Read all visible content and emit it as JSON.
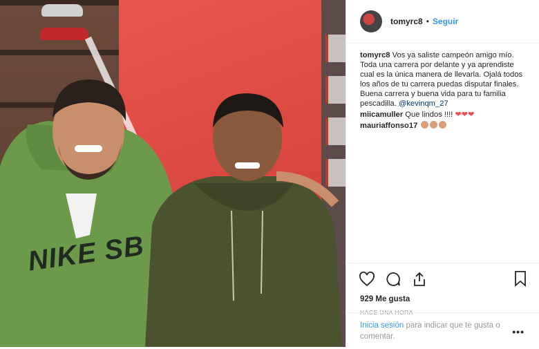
{
  "header": {
    "username": "tomyrc8",
    "separator": "•",
    "follow_label": "Seguir"
  },
  "caption": {
    "username": "tomyrc8",
    "text_before_mention": "Vos ya saliste campeón amigo mío. Toda una carrera por delante y ya aprendiste cual es la única manera de llevarla. Ojalá todos los años de tu carrera puedas disputar finales. Buena carrera y buena vida para tu familia pescadilla.",
    "mention": "@kevinqm_27"
  },
  "comments": [
    {
      "username": "miicamuller",
      "text": "Que lindos !!!!"
    },
    {
      "username": "mauriaffonso17",
      "text": ""
    }
  ],
  "likes": "929 Me gusta",
  "timestamp": "HACE UNA HORA",
  "login": {
    "link": "Inicia sesión",
    "rest": " para indicar que te gusta o comentar."
  },
  "more_label": "•••",
  "photo": {
    "shirt_text": "NIKE SB"
  },
  "colors": {
    "link": "#3897f0",
    "heart": "#ed4956",
    "text": "#262626",
    "muted": "#999999"
  }
}
